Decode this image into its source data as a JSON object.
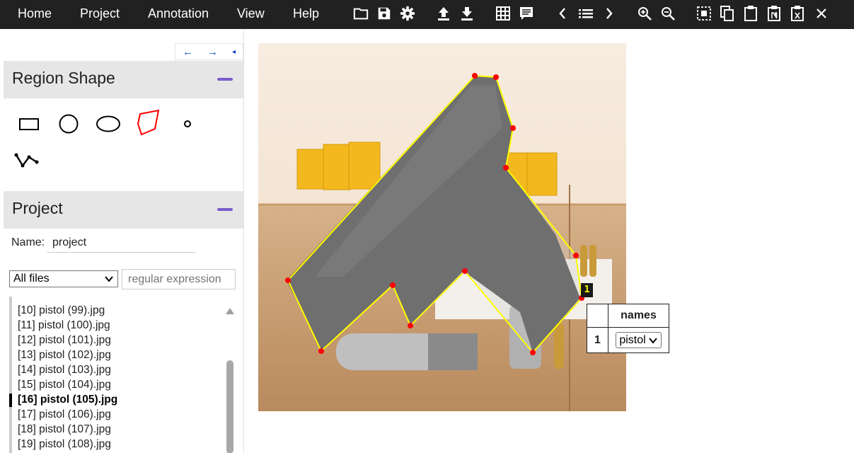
{
  "menu": {
    "home": "Home",
    "project": "Project",
    "annotation": "Annotation",
    "view": "View",
    "help": "Help"
  },
  "toolbar_icons": [
    "folder-open-icon",
    "save-icon",
    "gear-icon",
    "upload-icon",
    "download-icon",
    "grid-icon",
    "comment-icon",
    "chevron-left-icon",
    "list-icon",
    "chevron-right-icon",
    "zoom-in-icon",
    "zoom-out-icon",
    "select-all-icon",
    "copy-icon",
    "paste-icon",
    "paste-n-icon",
    "delete-region-icon",
    "close-icon"
  ],
  "nav": {
    "prev": "←",
    "next": "→",
    "collapse": "◂"
  },
  "region_shape": {
    "title": "Region Shape",
    "tools": [
      "rectangle",
      "circle",
      "ellipse",
      "polygon",
      "point",
      "polyline"
    ],
    "selected": "polygon"
  },
  "project": {
    "title": "Project",
    "name_label": "Name:",
    "name_value": "project",
    "filter_selected": "All files",
    "regex_placeholder": "regular expression",
    "files": [
      {
        "label": "[10] pistol (99).jpg",
        "active": false
      },
      {
        "label": "[11] pistol (100).jpg",
        "active": false
      },
      {
        "label": "[12] pistol (101).jpg",
        "active": false
      },
      {
        "label": "[13] pistol (102).jpg",
        "active": false
      },
      {
        "label": "[14] pistol (103).jpg",
        "active": false
      },
      {
        "label": "[15] pistol (104).jpg",
        "active": false
      },
      {
        "label": "[16] pistol (105).jpg",
        "active": true
      },
      {
        "label": "[17] pistol (106).jpg",
        "active": false
      },
      {
        "label": "[18] pistol (107).jpg",
        "active": false
      },
      {
        "label": "[19] pistol (108).jpg",
        "active": false
      }
    ]
  },
  "region": {
    "id_label": "1",
    "attribute_header": "names",
    "row_id": "1",
    "attribute_value": "pistol"
  },
  "colors": {
    "topbar": "#212121",
    "accent": "#7a5ccc",
    "polygon_edge": "#ffff00",
    "vertex": "#ff0000"
  }
}
